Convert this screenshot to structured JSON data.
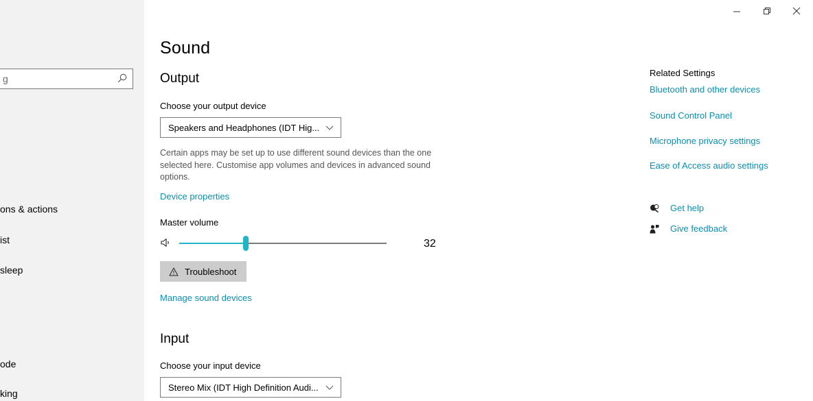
{
  "window": {
    "controls": {
      "minimize": "minimize-icon",
      "restore": "restore-icon",
      "close": "close-icon"
    }
  },
  "sidebar": {
    "search": {
      "value": "g",
      "icon": "search-icon"
    },
    "items": [
      {
        "label": "ons & actions"
      },
      {
        "label": "ist"
      },
      {
        "label": "sleep"
      },
      {
        "label": "ode"
      },
      {
        "label": "king"
      }
    ]
  },
  "main": {
    "title": "Sound",
    "output": {
      "heading": "Output",
      "choose_label": "Choose your output device",
      "device_value": "Speakers and Headphones (IDT Hig...",
      "description": "Certain apps may be set up to use different sound devices than the one selected here. Customise app volumes and devices in advanced sound options.",
      "device_properties_link": "Device properties",
      "master_volume_label": "Master volume",
      "volume_value": "32",
      "volume_fraction": 0.32,
      "troubleshoot_label": "Troubleshoot",
      "manage_link": "Manage sound devices"
    },
    "input": {
      "heading": "Input",
      "choose_label": "Choose your input device",
      "device_value": "Stereo Mix (IDT High Definition Audi..."
    }
  },
  "related": {
    "title": "Related Settings",
    "links": [
      "Bluetooth and other devices",
      "Sound Control Panel",
      "Microphone privacy settings",
      "Ease of Access audio settings"
    ],
    "help": [
      {
        "label": "Get help",
        "icon": "get-help-icon"
      },
      {
        "label": "Give feedback",
        "icon": "feedback-icon"
      }
    ]
  },
  "colors": {
    "accent": "#1eb5c9",
    "link": "#0a8fb0",
    "sidebar_bg": "#f2f2f2",
    "button_bg": "#cccccc"
  }
}
